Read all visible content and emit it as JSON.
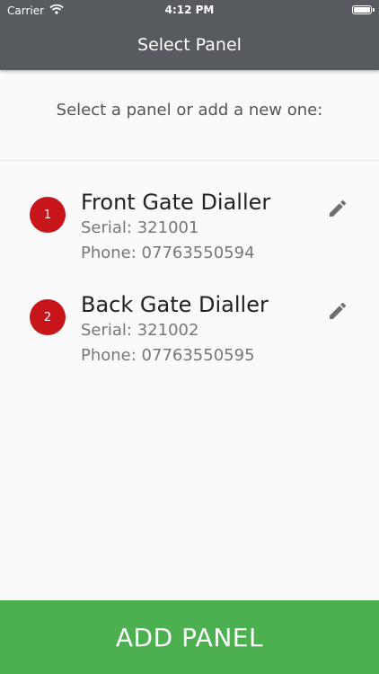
{
  "status_bar": {
    "carrier": "Carrier",
    "time": "4:12 PM",
    "wifi_icon": "wifi-icon",
    "battery_icon": "battery-icon"
  },
  "nav": {
    "title": "Select Panel"
  },
  "subtitle": "Select a panel or add a new one:",
  "panels": [
    {
      "number": "1",
      "name": "Front Gate Dialler",
      "serial": "Serial: 321001",
      "phone": "Phone: 07763550594",
      "edit_icon": "pencil-icon"
    },
    {
      "number": "2",
      "name": "Back Gate Dialler",
      "serial": "Serial: 321002",
      "phone": "Phone: 07763550595",
      "edit_icon": "pencil-icon"
    }
  ],
  "add_button_label": "ADD PANEL",
  "colors": {
    "header": "#575a5e",
    "badge": "#c8151b",
    "add_button": "#4caf50"
  }
}
